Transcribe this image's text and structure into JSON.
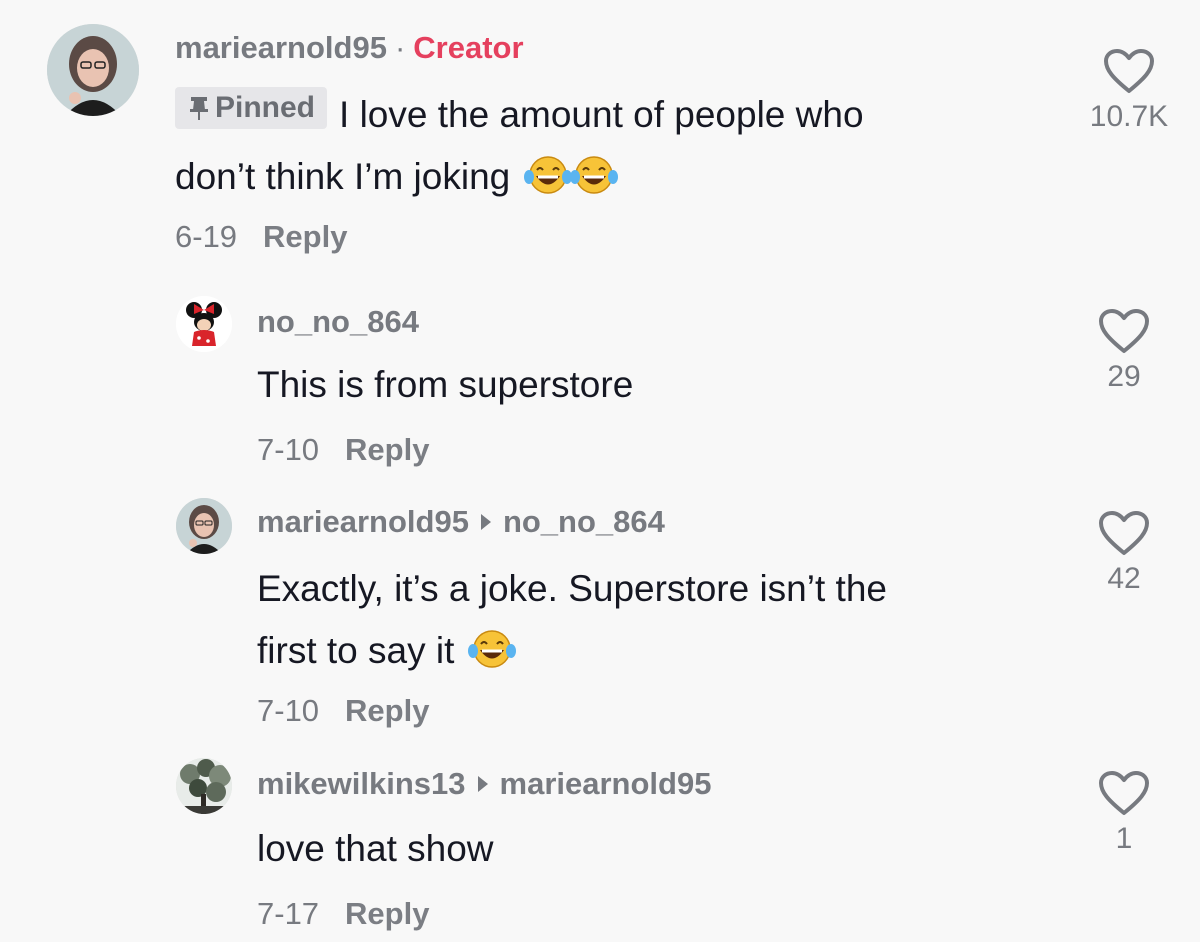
{
  "comments": [
    {
      "username": "mariearnold95",
      "separator": "·",
      "badge": "Creator",
      "pinned_label": "Pinned",
      "text_line1": "I love the amount of people who",
      "text_line2": "don’t think I’m joking",
      "date": "6-19",
      "reply_label": "Reply",
      "likes": "10.7K",
      "emoji_count": 2
    },
    {
      "username": "no_no_864",
      "text_line1": "This is from superstore",
      "date": "7-10",
      "reply_label": "Reply",
      "likes": "29"
    },
    {
      "username": "mariearnold95",
      "reply_to": "no_no_864",
      "text_line1": "Exactly, it’s a joke. Superstore isn’t the",
      "text_line2": "first to say it",
      "date": "7-10",
      "reply_label": "Reply",
      "likes": "42",
      "emoji_count": 1
    },
    {
      "username": "mikewilkins13",
      "reply_to": "mariearnold95",
      "text_line1": "love that show",
      "date": "7-17",
      "reply_label": "Reply",
      "likes": "1"
    }
  ],
  "icons": {
    "like": "heart-outline-icon",
    "pin": "pin-icon",
    "emoji": "tears-of-joy-emoji",
    "reply_arrow": "reply-arrow-icon"
  },
  "colors": {
    "background": "#f8f8f8",
    "creator_badge": "#e5405e",
    "meta_text": "#777a80"
  }
}
